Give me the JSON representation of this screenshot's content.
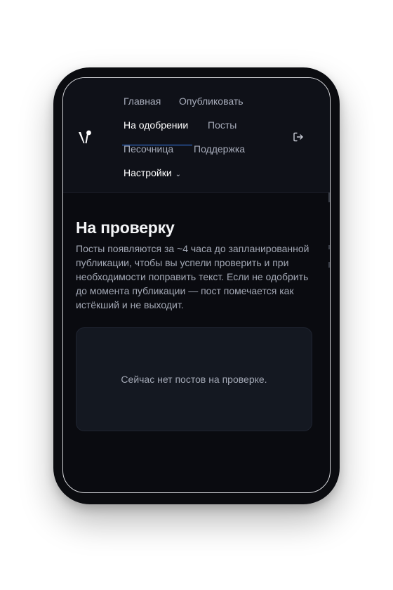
{
  "nav": {
    "home": "Главная",
    "publish": "Опубликовать",
    "approval": "На одобрении",
    "posts": "Посты",
    "sandbox": "Песочница",
    "support": "Поддержка",
    "settings": "Настройки"
  },
  "icons": {
    "logo": "brand-logo",
    "settings_chevron": "chevron-down-icon",
    "logout": "logout-icon"
  },
  "page": {
    "title": "На проверку",
    "description": "Посты появляются за ~4 часа до запланированной публикации, чтобы вы успели проверить и при необходимости поправить текст. Если не одобрить до момента публикации — пост помечается как истёкший и не выходит."
  },
  "empty_state": {
    "message": "Сейчас нет постов на проверке."
  },
  "colors": {
    "background": "#0a0b10",
    "header": "#0f1118",
    "accent": "#3b82f6",
    "text_primary": "#f3f4f6",
    "text_muted": "#a3a8b5"
  }
}
